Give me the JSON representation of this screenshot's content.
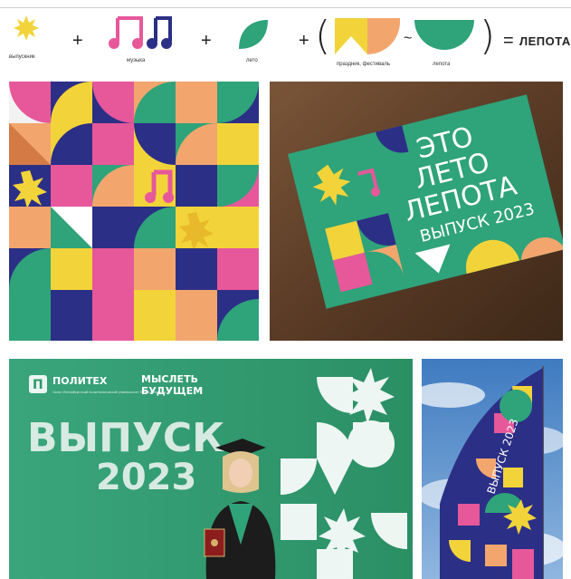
{
  "legend": {
    "graduate_caption": "выпускник",
    "music_caption": "музыка",
    "summer_caption": "лето",
    "holiday_caption": "праздник, фестиваль",
    "beauty_caption": "лепота",
    "plus": "+",
    "tilde": "~",
    "open_paren": "(",
    "close_paren": ")",
    "equals": "=",
    "result_word": "ЛЕПОТА"
  },
  "postcard": {
    "line1": "ЭТО",
    "line2": "ЛЕТО",
    "line3": "ЛЕПОТА",
    "line4": "ВЫПУСК 2023"
  },
  "banner": {
    "logo_text": "ПОЛИТЕХ",
    "logo_sub": "Санкт-Петербургский политехнический университет Петра Великого",
    "slogan_line1": "МЫСЛЕТЬ",
    "slogan_line2": "БУДУЩЕМ",
    "headline": "ВЫПУСК",
    "year": "2023"
  },
  "flag": {
    "text": "ВЫПУСК 2023"
  },
  "colors": {
    "green": "#2fa37a",
    "yellow": "#f2d43a",
    "pink": "#e6589a",
    "navy": "#2c2f86",
    "peach": "#f2a66e",
    "wood": "#6b4a32"
  }
}
